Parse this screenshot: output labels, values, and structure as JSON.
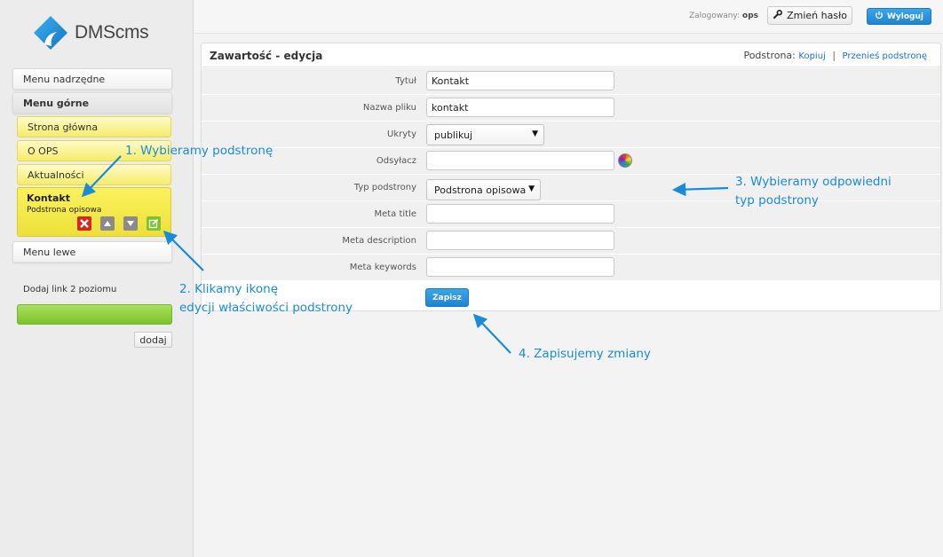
{
  "app": {
    "logo_text": "DMScms"
  },
  "topbar": {
    "logged_label": "Zalogowany:",
    "logged_user": "ops",
    "change_password": "Zmień hasło",
    "logout": "Wyloguj"
  },
  "sidebar": {
    "menu_parent": "Menu nadrzędne",
    "menu_top": "Menu górne",
    "items": [
      {
        "label": "Strona główna"
      },
      {
        "label": "O OPS"
      },
      {
        "label": "Aktualności"
      }
    ],
    "active_item": {
      "title": "Kontakt",
      "subtitle": "Podstrona opisowa"
    },
    "menu_left": "Menu lewe",
    "add_link_label": "Dodaj link 2 poziomu",
    "add_button": "dodaj"
  },
  "panel": {
    "title": "Zawartość - edycja",
    "subpage_label": "Podstrona:",
    "copy_link": "Kopiuj",
    "separator": "|",
    "move_link": "Przenieś podstronę"
  },
  "form": {
    "title_label": "Tytuł",
    "title_value": "Kontakt",
    "filename_label": "Nazwa pliku",
    "filename_value": "kontakt",
    "hidden_label": "Ukryty",
    "hidden_value": "publikuj",
    "redirect_label": "Odsyłacz",
    "redirect_value": "",
    "type_label": "Typ podstrony",
    "type_value": "Podstrona opisowa",
    "meta_title_label": "Meta title",
    "meta_title_value": "",
    "meta_desc_label": "Meta description",
    "meta_desc_value": "",
    "meta_keywords_label": "Meta keywords",
    "meta_keywords_value": "",
    "save": "Zapisz"
  },
  "annotations": {
    "step1": "1. Wybieramy podstronę",
    "step2_line1": "2. Klikamy ikonę",
    "step2_line2": "edycji właściwości podstrony",
    "step3_line1": "3. Wybieramy odpowiedni",
    "step3_line2": "typ podstrony",
    "step4": "4. Zapisujemy zmiany"
  },
  "colors": {
    "accent_blue": "#1f84cf",
    "annotation_blue": "#1a8bd6",
    "menu_yellow": "#f5ec6a",
    "add_green": "#7cc22b"
  }
}
